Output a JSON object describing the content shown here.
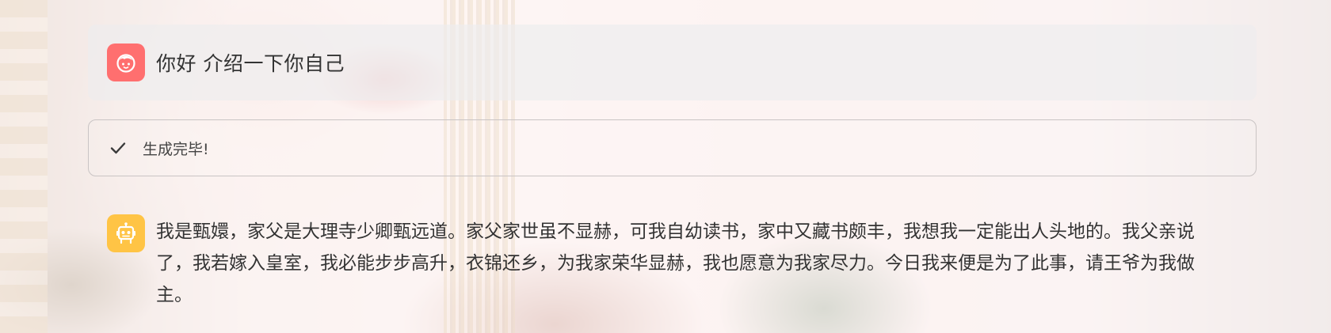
{
  "chat": {
    "user_message": {
      "avatar_icon": "child-face-icon",
      "avatar_color": "#ff6f6f",
      "text": "你好 介绍一下你自己"
    },
    "status": {
      "icon": "checkmark-icon",
      "text": "生成完毕!"
    },
    "assistant_message": {
      "avatar_icon": "robot-icon",
      "avatar_color": "#ffc445",
      "text": "我是甄嬛，家父是大理寺少卿甄远道。家父家世虽不显赫，可我自幼读书，家中又藏书颇丰，我想我一定能出人头地的。我父亲说了，我若嫁入皇室，我必能步步高升，衣锦还乡，为我家荣华显赫，我也愿意为我家尽力。今日我来便是为了此事，请王爷为我做主。"
    }
  }
}
